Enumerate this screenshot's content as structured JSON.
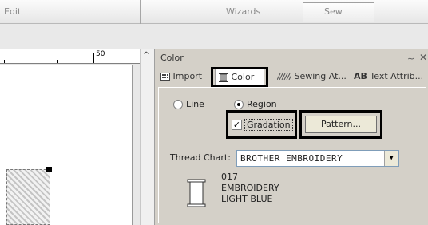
{
  "menubar": {
    "edit_label": "Edit",
    "wizards_label": "Wizards",
    "sew_label": "Sew"
  },
  "ruler": {
    "mark_label": "50"
  },
  "panel": {
    "title": "Color",
    "pin_glyph": "≂",
    "close_glyph": "✕",
    "tabs": [
      {
        "label": "Import",
        "icon": "import-icon"
      },
      {
        "label": "Color",
        "icon": "spool-icon"
      },
      {
        "label": "Sewing At...",
        "icon": "sewing-icon"
      },
      {
        "label": "Text Attrib...",
        "icon_text": "AB"
      }
    ],
    "radio_line": "Line",
    "radio_region": "Region",
    "selected_radio": "Region",
    "gradation_label": "Gradation",
    "gradation_checked": true,
    "pattern_label": "Pattern...",
    "thread_chart_label": "Thread Chart:",
    "thread_chart_value": "BROTHER EMBROIDERY",
    "thread": {
      "code": "017",
      "line1": "EMBROIDERY",
      "line2": "LIGHT BLUE"
    }
  }
}
